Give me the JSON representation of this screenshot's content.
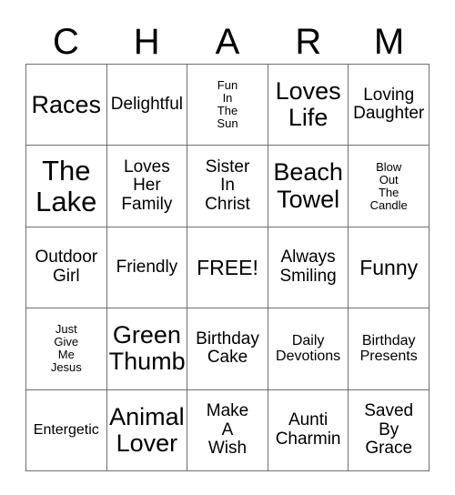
{
  "card": {
    "title_letters": [
      "C",
      "H",
      "A",
      "R",
      "M"
    ],
    "columns": 5,
    "rows": 5,
    "border_color": "#6f6f6f",
    "text_color": "#000000",
    "background_color": "#ffffff",
    "cells": [
      {
        "text": "Races",
        "size": "xl",
        "free": false
      },
      {
        "text": "Delightful",
        "size": "md",
        "free": false
      },
      {
        "text": "Fun\nIn\nThe\nSun",
        "size": "xs",
        "free": false
      },
      {
        "text": "Loves\nLife",
        "size": "xl",
        "free": false
      },
      {
        "text": "Loving\nDaughter",
        "size": "md",
        "free": false
      },
      {
        "text": "The\nLake",
        "size": "xxl",
        "free": false
      },
      {
        "text": "Loves\nHer\nFamily",
        "size": "md",
        "free": false
      },
      {
        "text": "Sister\nIn\nChrist",
        "size": "md",
        "free": false
      },
      {
        "text": "Beach\nTowel",
        "size": "xl",
        "free": false
      },
      {
        "text": "Blow\nOut\nThe\nCandle",
        "size": "xs",
        "free": false
      },
      {
        "text": "Outdoor\nGirl",
        "size": "md",
        "free": false
      },
      {
        "text": "Friendly",
        "size": "md",
        "free": false
      },
      {
        "text": "FREE!",
        "size": "lg",
        "free": true
      },
      {
        "text": "Always\nSmiling",
        "size": "md",
        "free": false
      },
      {
        "text": "Funny",
        "size": "lg",
        "free": false
      },
      {
        "text": "Just\nGive\nMe\nJesus",
        "size": "xs",
        "free": false
      },
      {
        "text": "Green\nThumb",
        "size": "xl",
        "free": false
      },
      {
        "text": "Birthday\nCake",
        "size": "md",
        "free": false
      },
      {
        "text": "Daily\nDevotions",
        "size": "sm",
        "free": false
      },
      {
        "text": "Birthday\nPresents",
        "size": "sm",
        "free": false
      },
      {
        "text": "Entergetic",
        "size": "sm",
        "free": false
      },
      {
        "text": "Animal\nLover",
        "size": "xl",
        "free": false
      },
      {
        "text": "Make\nA\nWish",
        "size": "md",
        "free": false
      },
      {
        "text": "Aunti\nCharmin",
        "size": "md",
        "free": false
      },
      {
        "text": "Saved\nBy\nGrace",
        "size": "md",
        "free": false
      }
    ]
  }
}
